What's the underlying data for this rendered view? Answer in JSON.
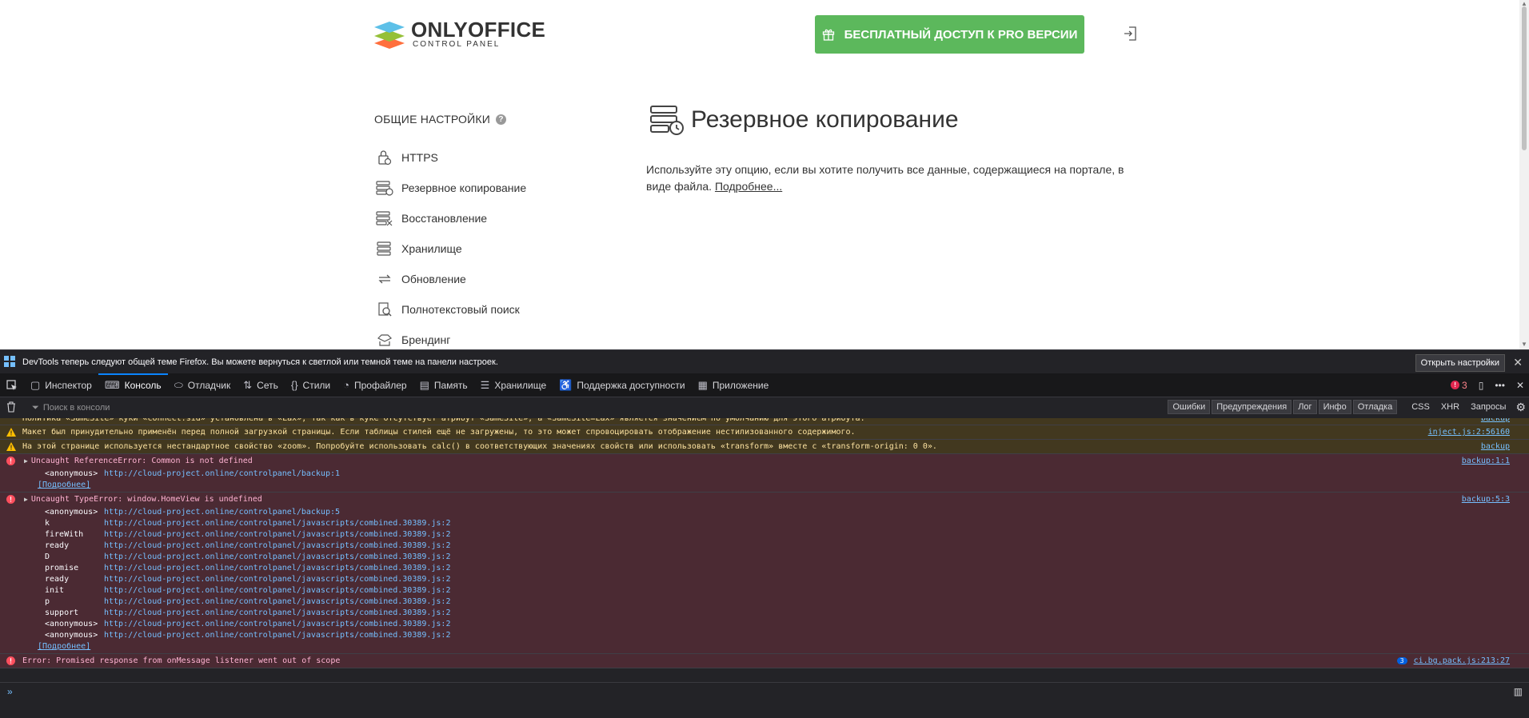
{
  "header": {
    "logo_title": "ONLYOFFICE",
    "logo_sub": "CONTROL PANEL",
    "pro_button": "БЕСПЛАТНЫЙ ДОСТУП К PRO ВЕРСИИ",
    "accent": "#5cb85c"
  },
  "sidebar": {
    "title": "ОБЩИЕ НАСТРОЙКИ",
    "items": [
      {
        "label": "HTTPS",
        "icon": "lock-icon"
      },
      {
        "label": "Резервное копирование",
        "icon": "backup-icon"
      },
      {
        "label": "Восстановление",
        "icon": "restore-icon"
      },
      {
        "label": "Хранилище",
        "icon": "storage-icon"
      },
      {
        "label": "Обновление",
        "icon": "update-icon"
      },
      {
        "label": "Полнотекстовый поиск",
        "icon": "search-icon"
      },
      {
        "label": "Брендинг",
        "icon": "branding-icon"
      }
    ]
  },
  "main": {
    "title": "Резервное копирование",
    "description": "Используйте эту опцию, если вы хотите получить все данные, содержащиеся на портале, в виде файла.",
    "more_link": "Подробнее..."
  },
  "devtools": {
    "notification": "DevTools теперь следуют общей теме Firefox. Вы можете вернуться к светлой или темной теме на панели настроек.",
    "open_settings": "Открыть настройки",
    "tabs": [
      "Инспектор",
      "Консоль",
      "Отладчик",
      "Сеть",
      "Стили",
      "Профайлер",
      "Память",
      "Хранилище",
      "Поддержка доступности",
      "Приложение"
    ],
    "error_count": "3",
    "filter_placeholder": "Поиск в консоли",
    "filters": [
      "Ошибки",
      "Предупреждения",
      "Лог",
      "Инфо",
      "Отладка"
    ],
    "plain_filters": [
      "CSS",
      "XHR",
      "Запросы"
    ],
    "messages": {
      "cut_text": "Политика «SameSite» куки «connect.sid» установлена в «Lax», так как в куке отсутствует атрибут «SameSite», а «SameSite=Lax» является значением по умолчанию для этого атрибута.",
      "cut_src": "backup",
      "warn1": "Макет был принудительно применён перед полной загрузкой страницы. Если таблицы стилей ещё не загружены, то это может спровоцировать отображение нестилизованного содержимого.",
      "warn1_src": "inject.js:2:56160",
      "warn2": "На этой странице используется нестандартное свойство «zoom». Попробуйте использовать calc() в соответствующих значениях свойств или использовать «transform» вместе с «transform-origin: 0 0».",
      "warn2_src": "backup",
      "err1": "Uncaught ReferenceError: Common is not defined",
      "err1_src": "backup:1:1",
      "err1_trace": [
        {
          "fn": "<anonymous>",
          "url": "http://cloud-project.online/controlpanel/backup:1"
        }
      ],
      "err2": "Uncaught TypeError: window.HomeView is undefined",
      "err2_src": "backup:5:3",
      "err2_trace": [
        {
          "fn": "<anonymous>",
          "url": "http://cloud-project.online/controlpanel/backup:5"
        },
        {
          "fn": "k",
          "url": "http://cloud-project.online/controlpanel/javascripts/combined.30389.js:2"
        },
        {
          "fn": "fireWith",
          "url": "http://cloud-project.online/controlpanel/javascripts/combined.30389.js:2"
        },
        {
          "fn": "ready",
          "url": "http://cloud-project.online/controlpanel/javascripts/combined.30389.js:2"
        },
        {
          "fn": "D",
          "url": "http://cloud-project.online/controlpanel/javascripts/combined.30389.js:2"
        },
        {
          "fn": "promise",
          "url": "http://cloud-project.online/controlpanel/javascripts/combined.30389.js:2"
        },
        {
          "fn": "ready",
          "url": "http://cloud-project.online/controlpanel/javascripts/combined.30389.js:2"
        },
        {
          "fn": "init",
          "url": "http://cloud-project.online/controlpanel/javascripts/combined.30389.js:2"
        },
        {
          "fn": "p",
          "url": "http://cloud-project.online/controlpanel/javascripts/combined.30389.js:2"
        },
        {
          "fn": "support",
          "url": "http://cloud-project.online/controlpanel/javascripts/combined.30389.js:2"
        },
        {
          "fn": "<anonymous>",
          "url": "http://cloud-project.online/controlpanel/javascripts/combined.30389.js:2"
        },
        {
          "fn": "<anonymous>",
          "url": "http://cloud-project.online/controlpanel/javascripts/combined.30389.js:2"
        }
      ],
      "more_label": "[Подробнее]",
      "err3": "Error: Promised response from onMessage listener went out of scope",
      "err3_count": "3",
      "err3_src": "ci.bg.pack.js:213:27"
    },
    "prompt": "»"
  }
}
